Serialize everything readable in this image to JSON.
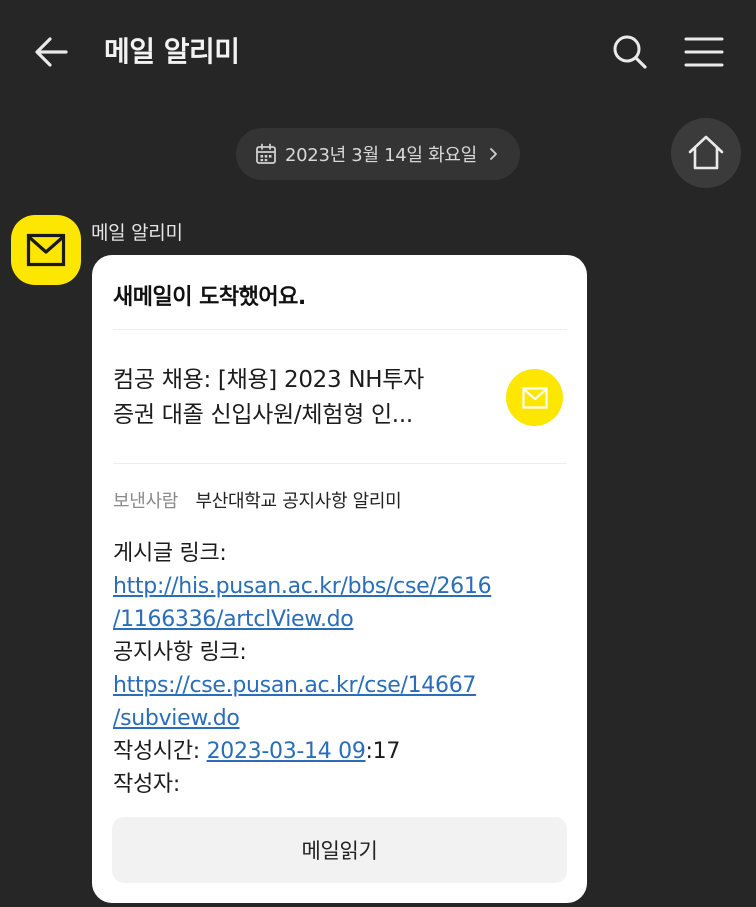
{
  "header": {
    "title": "메일 알리미"
  },
  "date_pill": {
    "text": "2023년 3월 14일 화요일"
  },
  "sender": {
    "name": "메일 알리미"
  },
  "card": {
    "title": "새메일이 도착했어요.",
    "subject_line1": "컴공 채용: [채용] 2023 NH투자",
    "subject_line2": "증권 대졸 신입사원/체험형 인...",
    "sender_label": "보낸사람",
    "sender_value": "부산대학교 공지사항 알리미",
    "body": {
      "post_link_label": "게시글 링크:",
      "post_link_line1": "http://his.pusan.ac.kr/bbs/cse/2616",
      "post_link_line2": "/1166336/artclView.do",
      "notice_link_label": "공지사항 링크:",
      "notice_link_line1": "https://cse.pusan.ac.kr/cse/14667",
      "notice_link_line2": "/subview.do",
      "time_label": "작성시간: ",
      "time_link": "2023-03-14 09",
      "time_rest": ":17",
      "author_label": "작성자:"
    },
    "read_button": "메일읽기"
  },
  "colors": {
    "background": "#262626",
    "accent_yellow": "#fde600",
    "link": "#2a6db8",
    "card": "#ffffff"
  },
  "icons": {
    "back": "arrow-left-icon",
    "search": "search-icon",
    "menu": "hamburger-menu-icon",
    "calendar": "calendar-icon",
    "chevron": "chevron-right-icon",
    "home": "home-icon",
    "avatar": "envelope-icon",
    "mail": "envelope-icon"
  }
}
